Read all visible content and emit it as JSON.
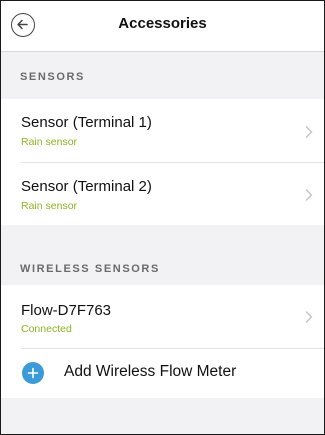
{
  "header": {
    "title": "Accessories"
  },
  "sections": [
    {
      "label": "SENSORS",
      "items": [
        {
          "title": "Sensor (Terminal 1)",
          "subtitle": "Rain sensor"
        },
        {
          "title": "Sensor (Terminal 2)",
          "subtitle": "Rain sensor"
        }
      ]
    },
    {
      "label": "WIRELESS SENSORS",
      "items": [
        {
          "title": "Flow-D7F763",
          "subtitle": "Connected"
        }
      ]
    }
  ],
  "add_action": {
    "label": "Add Wireless Flow Meter"
  },
  "colors": {
    "status_green": "#8cb523",
    "accent_blue": "#3a9bd8"
  },
  "icons": [
    "back-arrow-icon",
    "chevron-right-icon",
    "plus-icon"
  ]
}
